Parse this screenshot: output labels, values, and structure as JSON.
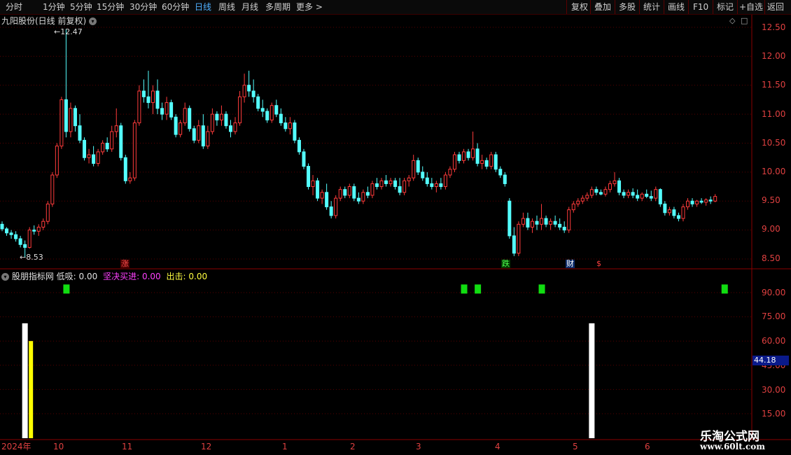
{
  "toolbar": {
    "left_items": [
      "分时",
      "1分钟",
      "5分钟",
      "15分钟",
      "30分钟",
      "60分钟",
      "日线",
      "周线",
      "月线",
      "多周期",
      "更多 >"
    ],
    "active_index": 6,
    "right_items": [
      "复权",
      "叠加",
      "多股",
      "统计",
      "画线",
      "F10",
      "标记",
      "+自选",
      "返回"
    ]
  },
  "chart": {
    "title": "九阳股份(日线 前复权)",
    "high_marker": "12.47",
    "low_marker": "8.53",
    "price_labels": [
      "12.50",
      "12.00",
      "11.50",
      "11.00",
      "10.50",
      "10.00",
      "9.50",
      "9.00",
      "8.50"
    ],
    "tags": [
      "涨",
      "跌",
      "财",
      "$"
    ]
  },
  "indicator": {
    "name": "股朋指标网",
    "low_label": "低吸:",
    "low_value": "0.00",
    "firm_label": "坚决买进:",
    "firm_value": "0.00",
    "strike_label": "出击:",
    "strike_value": "0.00",
    "axis_labels": [
      "90.00",
      "75.00",
      "60.00",
      "45.00",
      "30.00",
      "15.00"
    ],
    "current_value": "44.18"
  },
  "date_axis": [
    "2024年",
    "10",
    "11",
    "12",
    "1",
    "2",
    "3",
    "4",
    "5",
    "6"
  ],
  "watermark": {
    "line1": "乐淘公式网",
    "line2": "www.60lt.com"
  },
  "colors": {
    "up": "#ff3b3b",
    "down": "#54ffff",
    "grid": "#5a0000",
    "green_signal": "#11dd11",
    "yellow_bar": "#ffff00",
    "white_bar": "#ffffff",
    "active_tab": "#4fb0ff"
  },
  "chart_data": {
    "type": "candlestick",
    "price_range": [
      8.35,
      12.65
    ],
    "candles": [
      [
        9.1,
        9.15,
        8.98,
        9.02
      ],
      [
        9.02,
        9.05,
        8.9,
        8.95
      ],
      [
        8.95,
        9.0,
        8.85,
        8.92
      ],
      [
        8.92,
        8.98,
        8.8,
        8.85
      ],
      [
        8.85,
        8.9,
        8.7,
        8.75
      ],
      [
        8.75,
        8.82,
        8.53,
        8.7
      ],
      [
        8.7,
        9.05,
        8.68,
        9.0
      ],
      [
        9.0,
        9.08,
        8.92,
        8.98
      ],
      [
        8.98,
        9.1,
        8.9,
        9.05
      ],
      [
        9.05,
        9.2,
        9.0,
        9.15
      ],
      [
        9.15,
        9.5,
        9.1,
        9.45
      ],
      [
        9.45,
        10.0,
        9.4,
        9.95
      ],
      [
        9.95,
        10.5,
        9.9,
        10.45
      ],
      [
        10.45,
        11.3,
        10.4,
        11.25
      ],
      [
        11.25,
        12.47,
        10.6,
        10.7
      ],
      [
        10.7,
        11.2,
        10.6,
        11.1
      ],
      [
        11.1,
        11.15,
        10.7,
        10.8
      ],
      [
        10.8,
        11.0,
        10.5,
        10.55
      ],
      [
        10.55,
        10.6,
        10.2,
        10.25
      ],
      [
        10.25,
        10.4,
        10.15,
        10.3
      ],
      [
        10.3,
        10.45,
        10.1,
        10.15
      ],
      [
        10.15,
        10.4,
        10.1,
        10.35
      ],
      [
        10.35,
        10.55,
        10.3,
        10.5
      ],
      [
        10.5,
        10.6,
        10.35,
        10.4
      ],
      [
        10.4,
        10.8,
        10.35,
        10.7
      ],
      [
        10.7,
        11.1,
        10.6,
        10.8
      ],
      [
        10.8,
        10.85,
        10.2,
        10.25
      ],
      [
        10.25,
        10.3,
        9.8,
        9.85
      ],
      [
        9.85,
        10.0,
        9.8,
        9.9
      ],
      [
        9.9,
        10.9,
        9.85,
        10.85
      ],
      [
        10.85,
        11.5,
        10.8,
        11.4
      ],
      [
        11.4,
        11.6,
        11.2,
        11.3
      ],
      [
        11.3,
        11.75,
        11.1,
        11.2
      ],
      [
        11.2,
        11.5,
        11.0,
        11.4
      ],
      [
        11.4,
        11.6,
        11.0,
        11.1
      ],
      [
        11.1,
        11.2,
        10.9,
        11.0
      ],
      [
        11.0,
        11.3,
        10.9,
        11.2
      ],
      [
        11.2,
        11.25,
        10.9,
        10.95
      ],
      [
        10.95,
        11.0,
        10.6,
        10.65
      ],
      [
        10.65,
        10.9,
        10.6,
        10.85
      ],
      [
        10.85,
        11.2,
        10.8,
        11.1
      ],
      [
        11.1,
        11.15,
        10.7,
        10.75
      ],
      [
        10.75,
        10.8,
        10.5,
        10.55
      ],
      [
        10.55,
        10.9,
        10.5,
        10.8
      ],
      [
        10.8,
        11.0,
        10.4,
        10.45
      ],
      [
        10.45,
        10.8,
        10.4,
        10.7
      ],
      [
        10.7,
        11.1,
        10.65,
        11.0
      ],
      [
        11.0,
        11.05,
        10.8,
        10.9
      ],
      [
        10.9,
        11.15,
        10.8,
        11.0
      ],
      [
        11.0,
        11.05,
        10.75,
        10.8
      ],
      [
        10.8,
        10.9,
        10.6,
        10.7
      ],
      [
        10.7,
        10.95,
        10.65,
        10.85
      ],
      [
        10.85,
        11.4,
        10.8,
        11.3
      ],
      [
        11.3,
        11.7,
        11.2,
        11.5
      ],
      [
        11.5,
        11.75,
        11.3,
        11.4
      ],
      [
        11.4,
        11.6,
        11.2,
        11.3
      ],
      [
        11.3,
        11.35,
        11.05,
        11.1
      ],
      [
        11.1,
        11.25,
        10.95,
        11.05
      ],
      [
        11.05,
        11.1,
        10.85,
        10.9
      ],
      [
        10.9,
        11.2,
        10.85,
        11.15
      ],
      [
        11.15,
        11.25,
        10.95,
        11.0
      ],
      [
        11.0,
        11.1,
        10.8,
        10.85
      ],
      [
        10.85,
        10.95,
        10.7,
        10.75
      ],
      [
        10.75,
        10.95,
        10.65,
        10.85
      ],
      [
        10.85,
        10.9,
        10.5,
        10.55
      ],
      [
        10.55,
        10.6,
        10.3,
        10.35
      ],
      [
        10.35,
        10.4,
        10.05,
        10.1
      ],
      [
        10.1,
        10.15,
        9.7,
        9.75
      ],
      [
        9.75,
        9.95,
        9.6,
        9.85
      ],
      [
        9.85,
        9.9,
        9.5,
        9.55
      ],
      [
        9.55,
        9.7,
        9.45,
        9.65
      ],
      [
        9.65,
        9.8,
        9.35,
        9.4
      ],
      [
        9.4,
        9.5,
        9.2,
        9.25
      ],
      [
        9.25,
        9.6,
        9.2,
        9.55
      ],
      [
        9.55,
        9.75,
        9.5,
        9.7
      ],
      [
        9.7,
        9.75,
        9.55,
        9.6
      ],
      [
        9.6,
        9.8,
        9.55,
        9.75
      ],
      [
        9.75,
        9.8,
        9.5,
        9.55
      ],
      [
        9.55,
        9.65,
        9.45,
        9.5
      ],
      [
        9.5,
        9.7,
        9.45,
        9.65
      ],
      [
        9.65,
        9.75,
        9.55,
        9.6
      ],
      [
        9.6,
        9.85,
        9.55,
        9.8
      ],
      [
        9.8,
        9.9,
        9.7,
        9.75
      ],
      [
        9.75,
        9.9,
        9.7,
        9.85
      ],
      [
        9.85,
        9.95,
        9.75,
        9.8
      ],
      [
        9.8,
        9.9,
        9.75,
        9.85
      ],
      [
        9.85,
        9.9,
        9.7,
        9.75
      ],
      [
        9.75,
        9.9,
        9.6,
        9.65
      ],
      [
        9.65,
        9.9,
        9.6,
        9.85
      ],
      [
        9.85,
        9.95,
        9.75,
        9.9
      ],
      [
        9.9,
        10.3,
        9.85,
        10.2
      ],
      [
        10.2,
        10.25,
        9.95,
        10.0
      ],
      [
        10.0,
        10.1,
        9.85,
        9.9
      ],
      [
        9.9,
        10.0,
        9.75,
        9.8
      ],
      [
        9.8,
        9.9,
        9.7,
        9.75
      ],
      [
        9.75,
        9.85,
        9.65,
        9.8
      ],
      [
        9.8,
        9.9,
        9.7,
        9.75
      ],
      [
        9.75,
        10.0,
        9.7,
        9.95
      ],
      [
        9.95,
        10.1,
        9.9,
        10.05
      ],
      [
        10.05,
        10.35,
        10.0,
        10.3
      ],
      [
        10.3,
        10.35,
        10.15,
        10.2
      ],
      [
        10.2,
        10.4,
        10.15,
        10.35
      ],
      [
        10.35,
        10.4,
        10.2,
        10.25
      ],
      [
        10.25,
        10.7,
        10.2,
        10.4
      ],
      [
        10.4,
        10.5,
        10.1,
        10.15
      ],
      [
        10.15,
        10.3,
        10.05,
        10.2
      ],
      [
        10.2,
        10.25,
        10.05,
        10.1
      ],
      [
        10.1,
        10.35,
        10.05,
        10.3
      ],
      [
        10.3,
        10.35,
        10.0,
        10.05
      ],
      [
        10.05,
        10.1,
        9.9,
        9.95
      ],
      [
        9.95,
        10.0,
        9.75,
        9.8
      ],
      [
        9.5,
        9.55,
        8.85,
        8.9
      ],
      [
        8.9,
        9.05,
        8.55,
        8.6
      ],
      [
        8.6,
        9.15,
        8.55,
        9.1
      ],
      [
        9.1,
        9.3,
        9.05,
        9.2
      ],
      [
        9.2,
        9.3,
        9.0,
        9.05
      ],
      [
        9.05,
        9.2,
        8.95,
        9.15
      ],
      [
        9.15,
        9.25,
        9.0,
        9.1
      ],
      [
        9.1,
        9.45,
        9.0,
        9.2
      ],
      [
        9.2,
        9.25,
        9.05,
        9.1
      ],
      [
        9.1,
        9.2,
        9.0,
        9.15
      ],
      [
        9.15,
        9.25,
        9.05,
        9.1
      ],
      [
        9.1,
        9.2,
        9.0,
        9.05
      ],
      [
        9.05,
        9.15,
        8.95,
        9.0
      ],
      [
        9.0,
        9.4,
        8.95,
        9.35
      ],
      [
        9.35,
        9.5,
        9.3,
        9.45
      ],
      [
        9.45,
        9.55,
        9.4,
        9.5
      ],
      [
        9.5,
        9.6,
        9.45,
        9.55
      ],
      [
        9.55,
        9.65,
        9.5,
        9.6
      ],
      [
        9.6,
        9.75,
        9.55,
        9.7
      ],
      [
        9.7,
        9.75,
        9.6,
        9.65
      ],
      [
        9.65,
        9.7,
        9.6,
        9.62
      ],
      [
        9.62,
        9.75,
        9.58,
        9.7
      ],
      [
        9.7,
        9.85,
        9.65,
        9.8
      ],
      [
        9.8,
        10.0,
        9.75,
        9.85
      ],
      [
        9.85,
        9.9,
        9.6,
        9.65
      ],
      [
        9.65,
        9.7,
        9.55,
        9.6
      ],
      [
        9.6,
        9.7,
        9.55,
        9.65
      ],
      [
        9.65,
        9.72,
        9.55,
        9.6
      ],
      [
        9.6,
        9.7,
        9.5,
        9.55
      ],
      [
        9.55,
        9.65,
        9.5,
        9.62
      ],
      [
        9.62,
        9.7,
        9.55,
        9.58
      ],
      [
        9.58,
        9.68,
        9.5,
        9.55
      ],
      [
        9.55,
        9.75,
        9.5,
        9.7
      ],
      [
        9.7,
        9.72,
        9.4,
        9.45
      ],
      [
        9.45,
        9.5,
        9.25,
        9.3
      ],
      [
        9.3,
        9.4,
        9.25,
        9.35
      ],
      [
        9.35,
        9.4,
        9.2,
        9.25
      ],
      [
        9.25,
        9.3,
        9.15,
        9.2
      ],
      [
        9.2,
        9.45,
        9.15,
        9.4
      ],
      [
        9.4,
        9.55,
        9.35,
        9.5
      ],
      [
        9.5,
        9.55,
        9.4,
        9.45
      ],
      [
        9.45,
        9.52,
        9.4,
        9.5
      ],
      [
        9.5,
        9.55,
        9.45,
        9.48
      ],
      [
        9.48,
        9.55,
        9.42,
        9.52
      ],
      [
        9.52,
        9.58,
        9.45,
        9.5
      ],
      [
        9.5,
        9.62,
        9.48,
        9.58
      ]
    ],
    "indicator_range": [
      0,
      100
    ],
    "signals": [
      {
        "index": 14,
        "level": 92
      },
      {
        "index": 101,
        "level": 92
      },
      {
        "index": 104,
        "level": 92
      },
      {
        "index": 118,
        "level": 92
      },
      {
        "index": 158,
        "level": 92
      }
    ],
    "white_bars": [
      {
        "index": 5,
        "value": 71
      },
      {
        "index": 129,
        "value": 71
      }
    ],
    "yellow_bars": [
      {
        "index": 6,
        "value": 60
      }
    ]
  }
}
